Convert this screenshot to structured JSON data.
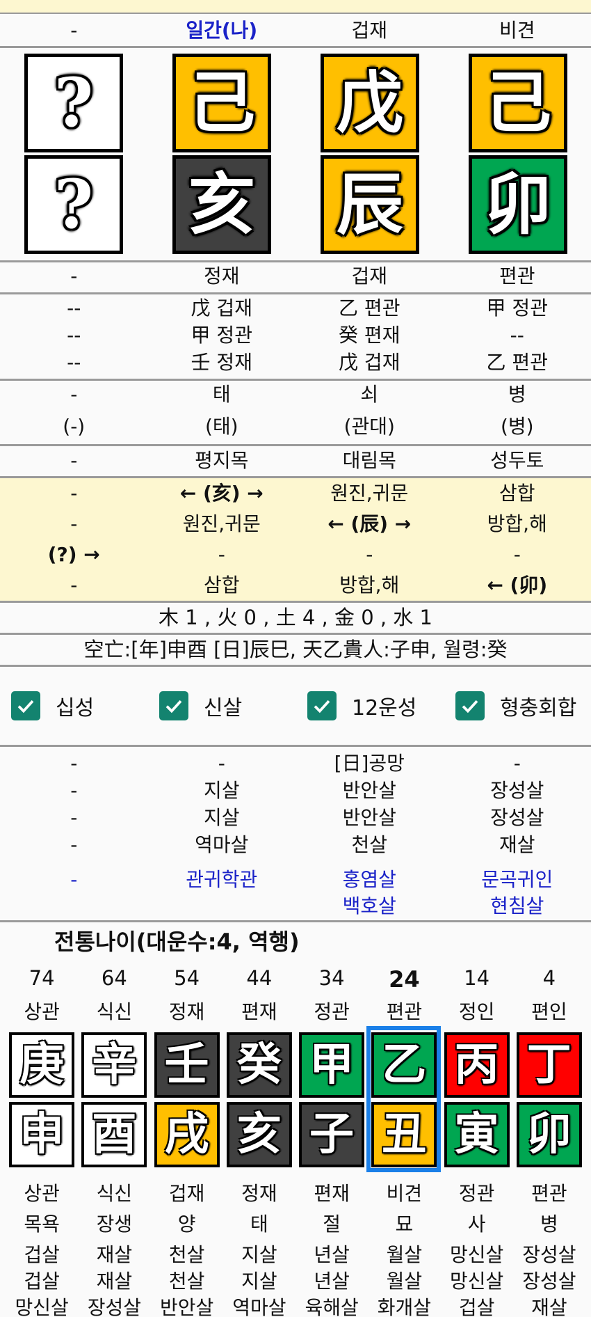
{
  "pillars": {
    "header": [
      "-",
      "일간(나)",
      "겁재",
      "비견"
    ],
    "stems": [
      {
        "char": "?",
        "element": "unknown",
        "color": "#ffffff"
      },
      {
        "char": "己",
        "element": "earth",
        "color": "#ffbf00"
      },
      {
        "char": "戊",
        "element": "earth",
        "color": "#ffbf00"
      },
      {
        "char": "己",
        "element": "earth",
        "color": "#ffbf00"
      }
    ],
    "branches": [
      {
        "char": "?",
        "element": "unknown",
        "color": "#ffffff"
      },
      {
        "char": "亥",
        "element": "water",
        "color": "#404040"
      },
      {
        "char": "辰",
        "element": "earth",
        "color": "#ffbf00"
      },
      {
        "char": "卯",
        "element": "wood",
        "color": "#00a651"
      }
    ],
    "branch_sipsung": [
      "-",
      "정재",
      "겁재",
      "편관"
    ],
    "hidden_stems": [
      [
        "--",
        "戊 겁재",
        "乙 편관",
        "甲 정관"
      ],
      [
        "--",
        "甲 정관",
        "癸 편재",
        "--"
      ],
      [
        "--",
        "壬 정재",
        "戊 겁재",
        "乙 편관"
      ]
    ],
    "unseong": [
      "-",
      "태",
      "쇠",
      "병"
    ],
    "unseong_alt": [
      "(-)",
      "(태)",
      "(관대)",
      "(병)"
    ],
    "napeum": [
      "-",
      "평지목",
      "대림목",
      "성두토"
    ],
    "relations": [
      [
        "-",
        "← (亥) →",
        "원진,귀문",
        "삼합"
      ],
      [
        "-",
        "원진,귀문",
        "← (辰) →",
        "방합,해"
      ],
      [
        "(?) →",
        "-",
        "-",
        "-"
      ],
      [
        "-",
        "삼합",
        "방합,해",
        "← (卯)"
      ]
    ]
  },
  "element_count": "木 1 , 火 0 , 土 4 , 金 0 , 水 1",
  "gongmang_line": "空亡:[年]申酉 [日]辰巳, 天乙貴人:子申, 월령:癸",
  "checkboxes": [
    {
      "label": "십성",
      "checked": true
    },
    {
      "label": "신살",
      "checked": true
    },
    {
      "label": "12운성",
      "checked": true
    },
    {
      "label": "형충회합",
      "checked": true
    }
  ],
  "sinsal": {
    "rows": [
      [
        "-",
        "-",
        "[日]공망",
        "-"
      ],
      [
        "-",
        "지살",
        "반안살",
        "장성살"
      ],
      [
        "-",
        "지살",
        "반안살",
        "장성살"
      ],
      [
        "-",
        "역마살",
        "천살",
        "재살"
      ]
    ],
    "special_rows": [
      [
        "-",
        "관귀학관",
        "홍염살",
        "문곡귀인"
      ],
      [
        "",
        "",
        "백호살",
        "현침살"
      ]
    ],
    "special_color": "#1a22c8"
  },
  "daeun": {
    "title": "전통나이(대운수:4, 역행)",
    "selected_index": 5,
    "ages": [
      "74",
      "64",
      "54",
      "44",
      "34",
      "24",
      "14",
      "4"
    ],
    "stem_sipsung": [
      "상관",
      "식신",
      "정재",
      "편재",
      "정관",
      "편관",
      "정인",
      "편인"
    ],
    "stems": [
      {
        "char": "庚",
        "color": "#ffffff"
      },
      {
        "char": "辛",
        "color": "#ffffff"
      },
      {
        "char": "壬",
        "color": "#404040"
      },
      {
        "char": "癸",
        "color": "#404040"
      },
      {
        "char": "甲",
        "color": "#00a651"
      },
      {
        "char": "乙",
        "color": "#00a651"
      },
      {
        "char": "丙",
        "color": "#ff0000"
      },
      {
        "char": "丁",
        "color": "#ff0000"
      }
    ],
    "branches": [
      {
        "char": "申",
        "color": "#ffffff"
      },
      {
        "char": "酉",
        "color": "#ffffff"
      },
      {
        "char": "戌",
        "color": "#ffbf00"
      },
      {
        "char": "亥",
        "color": "#404040"
      },
      {
        "char": "子",
        "color": "#404040"
      },
      {
        "char": "丑",
        "color": "#ffbf00"
      },
      {
        "char": "寅",
        "color": "#00a651"
      },
      {
        "char": "卯",
        "color": "#00a651"
      }
    ],
    "branch_sipsung": [
      "상관",
      "식신",
      "겁재",
      "정재",
      "편재",
      "비견",
      "정관",
      "편관"
    ],
    "unseong": [
      "목욕",
      "장생",
      "양",
      "태",
      "절",
      "묘",
      "사",
      "병"
    ],
    "sinsal_1": [
      "겁살",
      "재살",
      "천살",
      "지살",
      "년살",
      "월살",
      "망신살",
      "장성살"
    ],
    "sinsal_2": [
      "겁살",
      "재살",
      "천살",
      "지살",
      "년살",
      "월살",
      "망신살",
      "장성살"
    ],
    "sinsal_3": [
      "망신살",
      "장성살",
      "반안살",
      "역마살",
      "육해살",
      "화개살",
      "겁살",
      "재살"
    ],
    "highlight_color": "#1a7fe8"
  }
}
